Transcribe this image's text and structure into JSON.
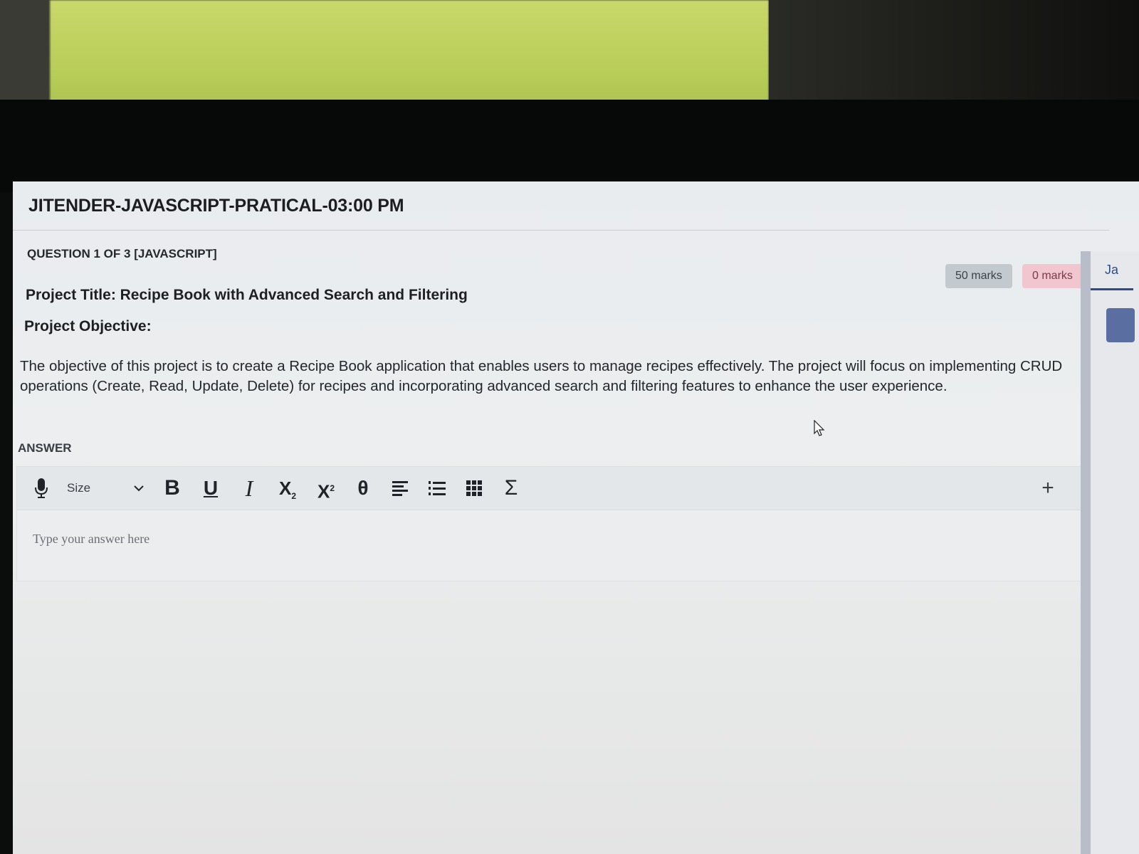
{
  "exam": {
    "title": "JITENDER-JAVASCRIPT-PRATICAL-03:00 PM"
  },
  "question": {
    "label": "QUESTION 1 OF 3 [JAVASCRIPT]",
    "total_marks": "50 marks",
    "scored_marks": "0 marks",
    "project_title": "Project Title: Recipe Book with Advanced Search and Filtering",
    "objective_heading": "Project Objective:",
    "objective_text": "The objective of this project is to create a Recipe Book application that enables users to manage recipes effectively. The project will focus on implementing CRUD operations (Create, Read, Update, Delete) for recipes and incorporating advanced search and filtering features to enhance the user experience."
  },
  "answer": {
    "label": "ANSWER",
    "placeholder": "Type your answer here",
    "value": ""
  },
  "toolbar": {
    "size_label": "Size",
    "bold": "B",
    "underline": "U",
    "italic": "I",
    "subscript": "X",
    "subscript_mark": "2",
    "superscript": "X",
    "superscript_mark": "2",
    "theta": "θ",
    "sigma": "Σ",
    "plus": "+",
    "icons": [
      "mic-icon",
      "chevron-down-icon",
      "align-left-icon",
      "numbered-list-icon",
      "table-icon",
      "sigma-icon",
      "plus-icon"
    ]
  },
  "side_panel": {
    "tab_label": "Ja"
  },
  "colors": {
    "marks_total_bg": "#c3cacf",
    "marks_scored_bg": "#f2c6cf",
    "side_accent": "#2d4c86"
  }
}
